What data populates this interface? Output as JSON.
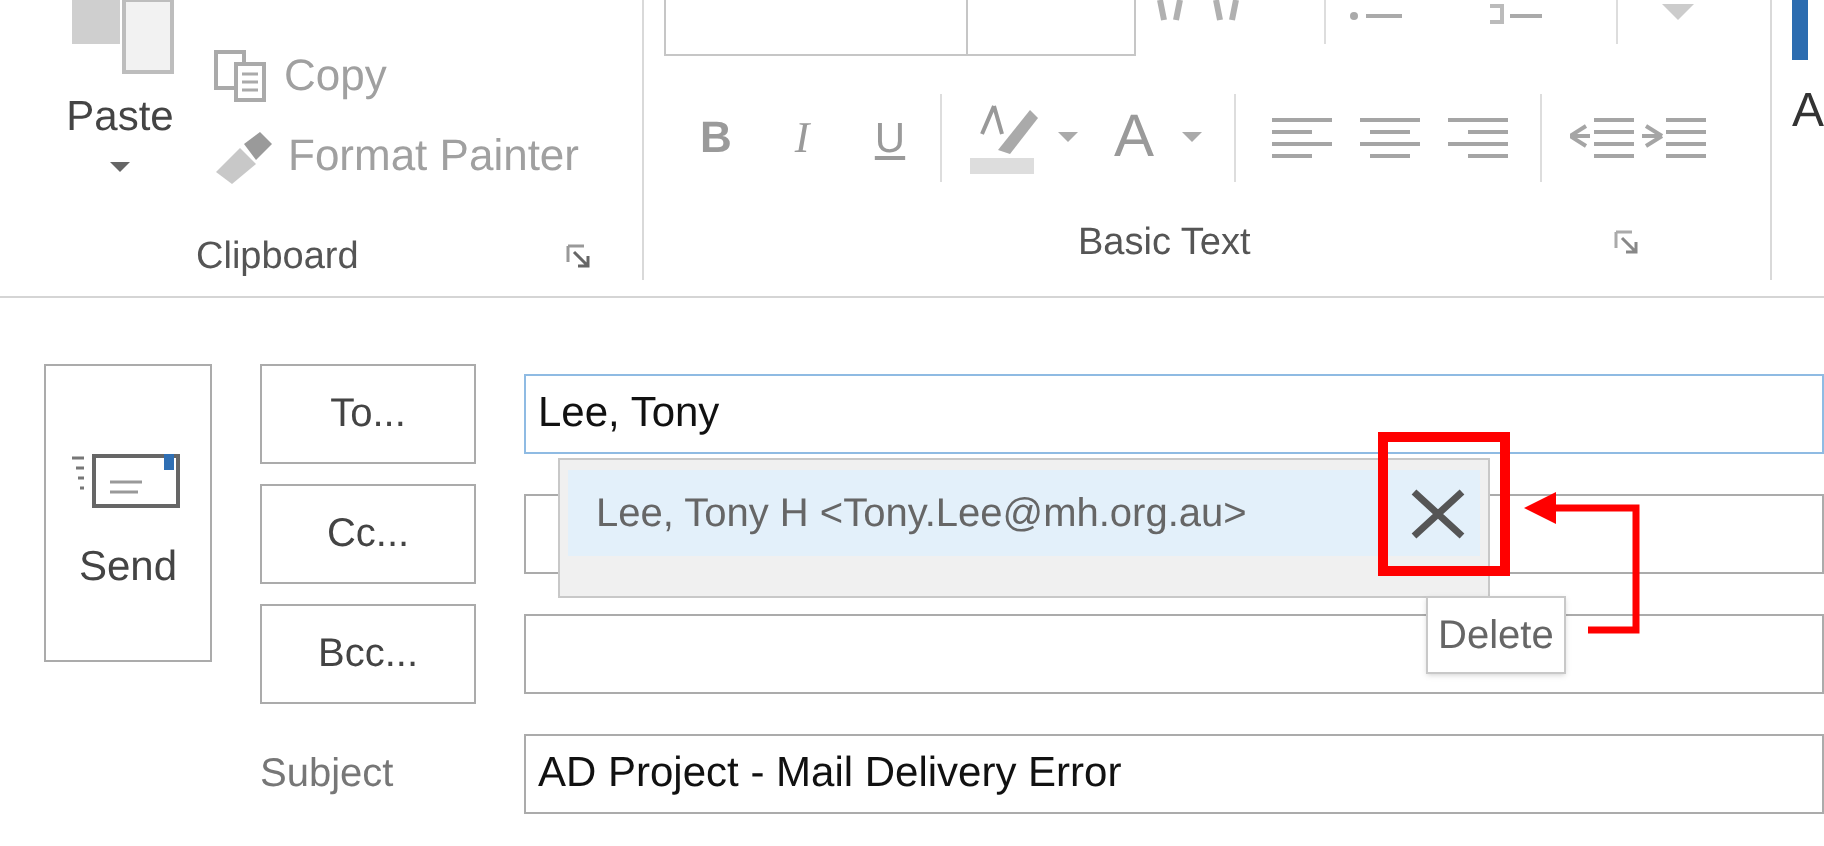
{
  "ribbon": {
    "clipboard": {
      "label": "Clipboard",
      "paste": {
        "label": "Paste"
      },
      "copy": {
        "label": "Copy"
      },
      "format_painter": {
        "label": "Format Painter"
      }
    },
    "basic_text": {
      "label": "Basic Text",
      "bold": {
        "label": "B"
      },
      "italic": {
        "label": "I"
      },
      "underline": {
        "label": "U"
      },
      "font_color": {
        "label": "A"
      }
    },
    "next_group": {
      "label": "A"
    }
  },
  "compose": {
    "send_button": {
      "label": "Send"
    },
    "address_rows": [
      {
        "kind": "button",
        "label": "To...",
        "value": "Lee, Tony",
        "focused": true
      },
      {
        "kind": "button",
        "label": "Cc...",
        "focused": false
      },
      {
        "kind": "button",
        "label": "Bcc...",
        "focused": false
      },
      {
        "kind": "label",
        "label": "Subject",
        "value": "AD Project - Mail Delivery Error",
        "focused": false
      }
    ],
    "autocomplete": {
      "items": [
        {
          "text": "Lee, Tony H <Tony.Lee@mh.org.au>",
          "selected": true
        }
      ]
    },
    "tooltip": {
      "text": "Delete"
    }
  }
}
